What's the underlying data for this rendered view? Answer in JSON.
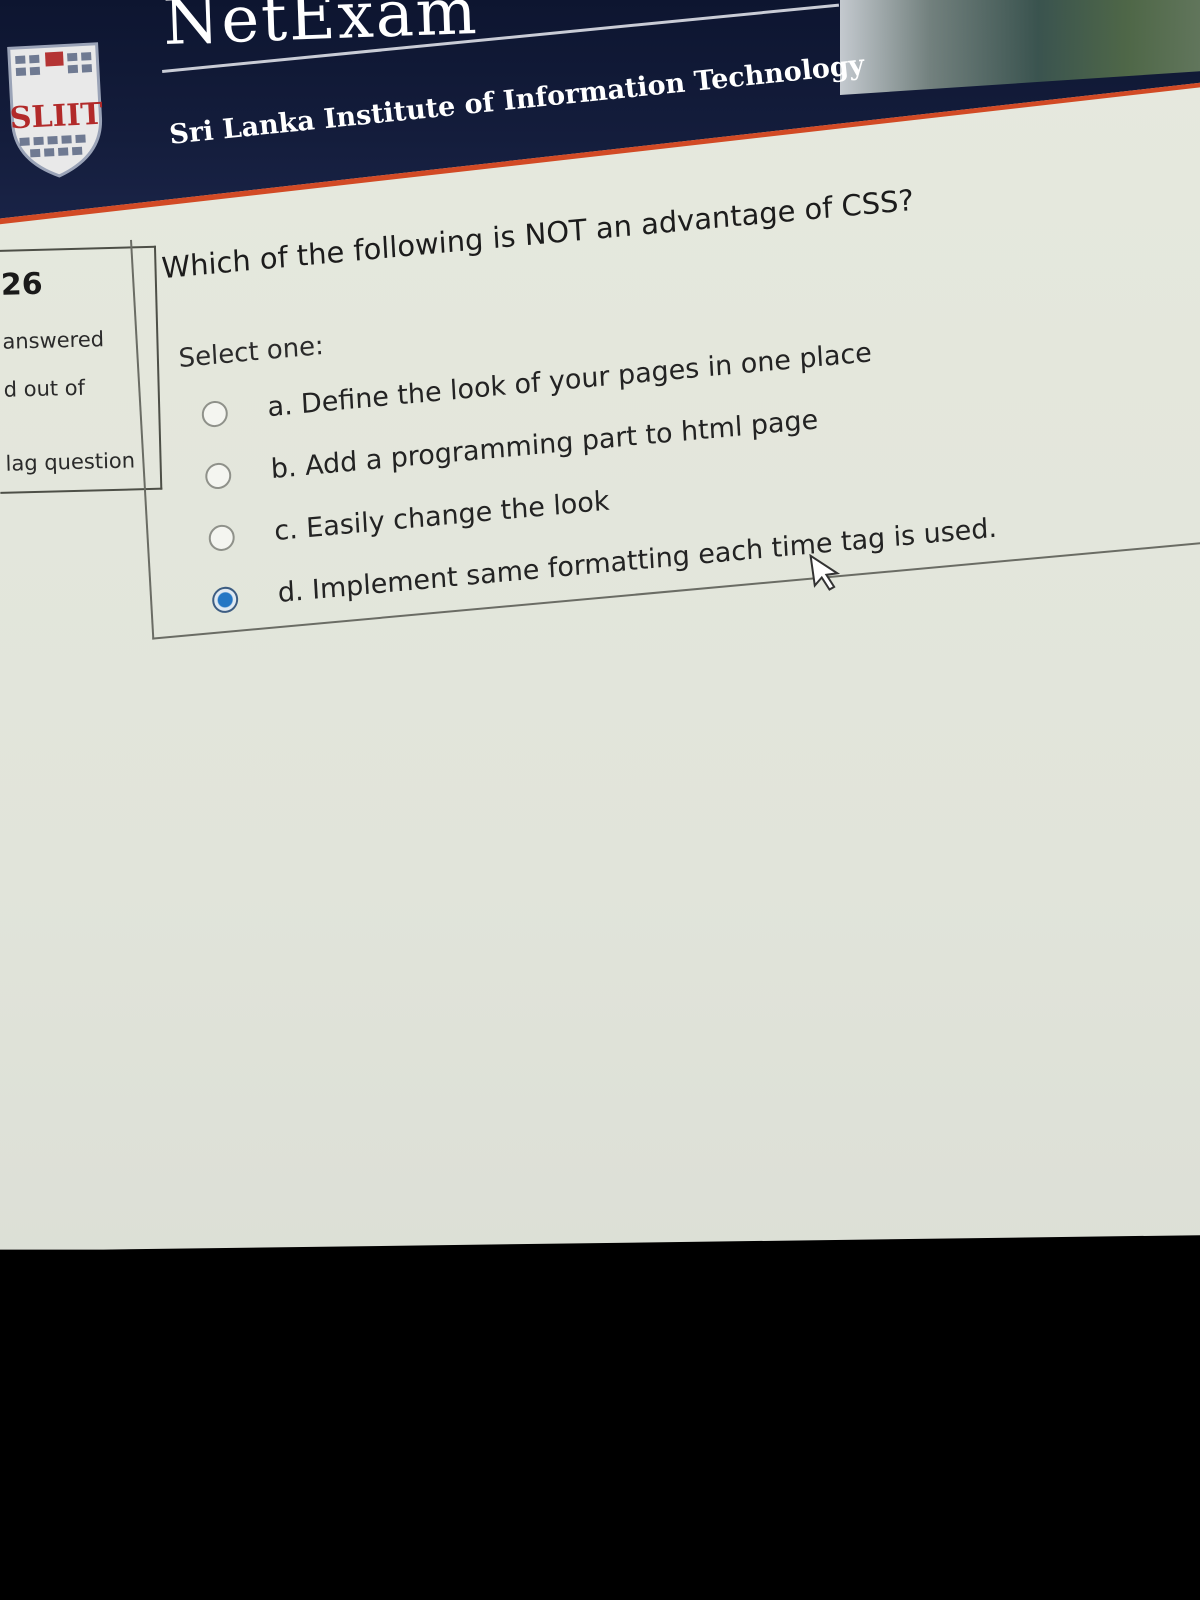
{
  "header": {
    "site_title": "NetExam",
    "institute": "Sri Lanka Institute of Information Technology",
    "logo_text": "SLIIT"
  },
  "quiz_info": {
    "question_number": "26",
    "status": "answered",
    "marks": "d out of",
    "flag": "lag question"
  },
  "question": {
    "text": "Which of the following is NOT an advantage of CSS?",
    "prompt": "Select one:",
    "options": [
      {
        "label": "a. Define the look of your pages in one place",
        "selected": false
      },
      {
        "label": "b. Add a programming part to html page",
        "selected": false
      },
      {
        "label": "c. Easily change the look",
        "selected": false
      },
      {
        "label": "d. Implement same formatting each time tag is used.",
        "selected": true
      }
    ]
  },
  "colors": {
    "header_bg": "#141d3c",
    "accent_strip": "#d24a25",
    "radio_selected": "#2476c4"
  }
}
